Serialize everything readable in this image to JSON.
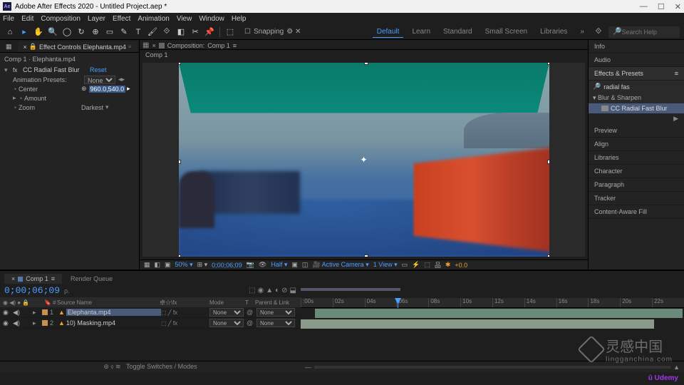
{
  "titlebar": {
    "app": "Adobe After Effects 2020",
    "project": "Untitled Project.aep *"
  },
  "menu": [
    "File",
    "Edit",
    "Composition",
    "Layer",
    "Effect",
    "Animation",
    "View",
    "Window",
    "Help"
  ],
  "toolbar": {
    "snapping": "Snapping",
    "workspaces": [
      "Default",
      "Learn",
      "Standard",
      "Small Screen",
      "Libraries"
    ],
    "active_ws": "Default",
    "search_placeholder": "Search Help"
  },
  "effect_panel": {
    "tab": "Effect Controls Elephanta.mp4",
    "breadcrumb": "Comp 1 · Elephanta.mp4",
    "effect_name": "CC Radial Fast Blur",
    "reset": "Reset",
    "presets_label": "Animation Presets:",
    "presets_value": "None",
    "props": {
      "center": {
        "label": "Center",
        "value": "960.0,540.0"
      },
      "amount": {
        "label": "Amount"
      },
      "zoom": {
        "label": "Zoom",
        "value": "Darkest"
      }
    }
  },
  "comp_panel": {
    "crumb_prefix": "Composition:",
    "comp_name": "Comp 1",
    "footer": {
      "mag": "50%",
      "time": "0;00;06;09",
      "res": "Half",
      "camera": "Active Camera",
      "view": "1 View",
      "exposure": "+0.0"
    }
  },
  "right": {
    "info": "Info",
    "audio": "Audio",
    "ep_header": "Effects & Presets",
    "search": "radial fas",
    "category": "Blur & Sharpen",
    "effect": "CC Radial Fast Blur",
    "panels": [
      "Preview",
      "Align",
      "Libraries",
      "Character",
      "Paragraph",
      "Tracker",
      "Content-Aware Fill"
    ]
  },
  "timeline": {
    "tab_comp": "Comp 1",
    "tab_rq": "Render Queue",
    "timecode": "0;00;06;09",
    "search_ph": "ρ.",
    "col_source": "Source Name",
    "col_switches": "卓☆\\fx",
    "col_mode": "Mode",
    "col_t": "T",
    "col_parent": "Parent & Link",
    "ruler": [
      ":00s",
      "02s",
      "04s",
      "06s",
      "08s",
      "10s",
      "12s",
      "14s",
      "16s",
      "18s",
      "20s",
      "22s"
    ],
    "layers": [
      {
        "num": "1",
        "name": "Elephanta.mp4",
        "selected": true,
        "mode": "None",
        "parent": "None"
      },
      {
        "num": "2",
        "name": "10) Masking.mp4",
        "selected": false,
        "mode": "None",
        "parent": "None"
      }
    ],
    "toggle": "Toggle Switches / Modes"
  },
  "watermark": {
    "cn": "灵感中国",
    "en": "lingganchina",
    "tld": ".com"
  },
  "udemy": "Udemy"
}
